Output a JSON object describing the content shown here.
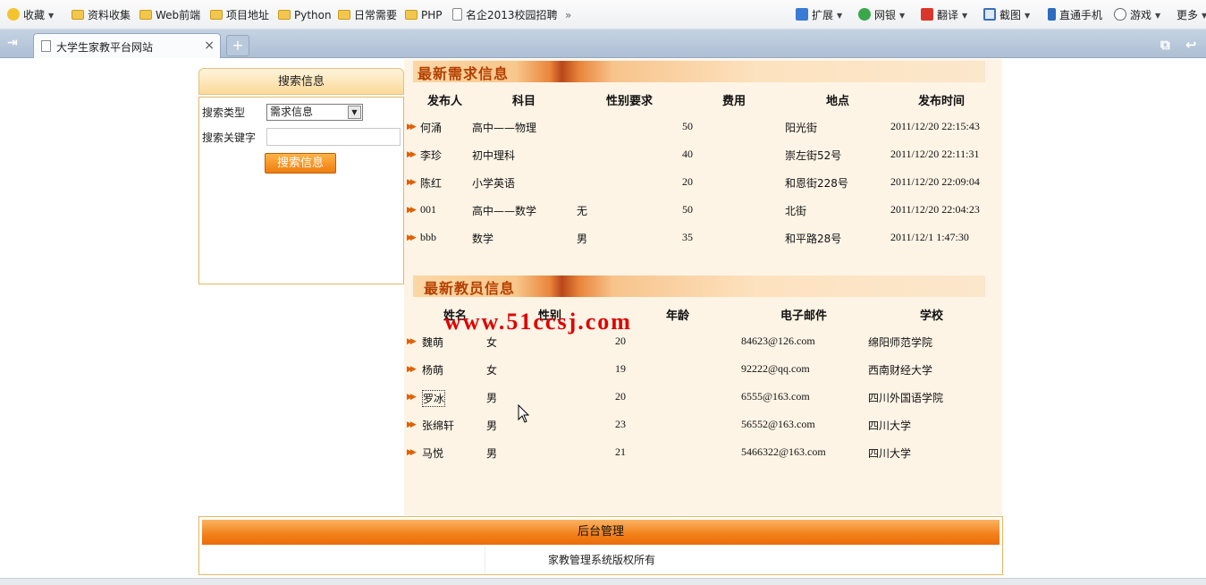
{
  "browser": {
    "bookmarks": [
      {
        "label": "收藏",
        "icon": "star-add-icon",
        "dropdown": true
      },
      {
        "label": "资料收集",
        "icon": "folder-icon"
      },
      {
        "label": "Web前端",
        "icon": "folder-icon"
      },
      {
        "label": "项目地址",
        "icon": "folder-icon"
      },
      {
        "label": "Python",
        "icon": "folder-icon"
      },
      {
        "label": "日常需要",
        "icon": "folder-icon"
      },
      {
        "label": "PHP",
        "icon": "folder-icon"
      },
      {
        "label": "名企2013校园招聘",
        "icon": "page-icon"
      }
    ],
    "more_bookmarks": "»",
    "toolbar": [
      {
        "label": "扩展",
        "icon": "extensions-icon",
        "dropdown": true
      },
      {
        "label": "网银",
        "icon": "bank-icon",
        "dropdown": true
      },
      {
        "label": "翻译",
        "icon": "translate-icon",
        "dropdown": true
      },
      {
        "label": "截图",
        "icon": "screenshot-icon",
        "dropdown": true
      },
      {
        "label": "直通手机",
        "icon": "phone-icon"
      },
      {
        "label": "游戏",
        "icon": "game-icon",
        "dropdown": true
      },
      {
        "label": "更多",
        "icon": "more-icon",
        "dropdown": true
      }
    ],
    "tab_title": "大学生家教平台网站",
    "tab_close": "×",
    "new_tab": "+"
  },
  "search_panel": {
    "title": "搜索信息",
    "type_label": "搜索类型",
    "type_value": "需求信息",
    "keyword_label": "搜索关键字",
    "keyword_value": "",
    "button": "搜索信息"
  },
  "demand": {
    "title": "最新需求信息",
    "columns": [
      "发布人",
      "科目",
      "性别要求",
      "费用",
      "地点",
      "发布时间"
    ],
    "rows": [
      [
        "何涌",
        "高中——物理",
        "",
        "50",
        "阳光街",
        "2011/12/20 22:15:43"
      ],
      [
        "李珍",
        "初中理科",
        "",
        "40",
        "崇左街52号",
        "2011/12/20 22:11:31"
      ],
      [
        "陈红",
        "小学英语",
        "",
        "20",
        "和恩街228号",
        "2011/12/20 22:09:04"
      ],
      [
        "001",
        "高中——数学",
        "无",
        "50",
        "北街",
        "2011/12/20 22:04:23"
      ],
      [
        "bbb",
        "数学",
        "男",
        "35",
        "和平路28号",
        "2011/12/1 1:47:30"
      ]
    ]
  },
  "teachers": {
    "title": "最新教员信息",
    "columns": [
      "姓名",
      "性别",
      "年龄",
      "电子邮件",
      "学校"
    ],
    "rows": [
      [
        "魏萌",
        "女",
        "20",
        "84623@126.com",
        "绵阳师范学院"
      ],
      [
        "杨萌",
        "女",
        "19",
        "92222@qq.com",
        "西南财经大学"
      ],
      [
        "罗冰",
        "男",
        "20",
        "6555@163.com",
        "四川外国语学院"
      ],
      [
        "张绵轩",
        "男",
        "23",
        "56552@163.com",
        "四川大学"
      ],
      [
        "马悦",
        "男",
        "21",
        "5466322@163.com",
        "四川大学"
      ]
    ]
  },
  "watermark": "www.51ccsj.com",
  "footer": {
    "admin_link": "后台管理",
    "copyright": "家教管理系统版权所有"
  },
  "colors": {
    "accent": "#f07c0e",
    "section_title": "#b43f00",
    "content_bg": "#fdf4e6",
    "tab_bar": "#b6c6d8"
  }
}
